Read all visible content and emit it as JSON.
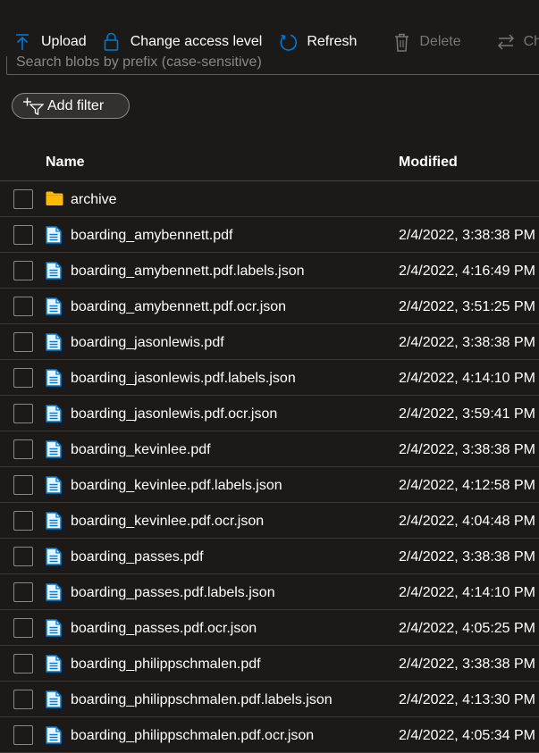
{
  "toolbar": {
    "upload_label": "Upload",
    "access_label": "Change access level",
    "refresh_label": "Refresh",
    "delete_label": "Delete",
    "change_label": "Cha"
  },
  "search": {
    "placeholder": "Search blobs by prefix (case-sensitive)"
  },
  "filter": {
    "label": "Add filter"
  },
  "table": {
    "columns": [
      "Name",
      "Modified"
    ],
    "rows": [
      {
        "type": "folder",
        "name": "archive",
        "modified": ""
      },
      {
        "type": "file",
        "name": "boarding_amybennett.pdf",
        "modified": "2/4/2022, 3:38:38 PM"
      },
      {
        "type": "file",
        "name": "boarding_amybennett.pdf.labels.json",
        "modified": "2/4/2022, 4:16:49 PM"
      },
      {
        "type": "file",
        "name": "boarding_amybennett.pdf.ocr.json",
        "modified": "2/4/2022, 3:51:25 PM"
      },
      {
        "type": "file",
        "name": "boarding_jasonlewis.pdf",
        "modified": "2/4/2022, 3:38:38 PM"
      },
      {
        "type": "file",
        "name": "boarding_jasonlewis.pdf.labels.json",
        "modified": "2/4/2022, 4:14:10 PM"
      },
      {
        "type": "file",
        "name": "boarding_jasonlewis.pdf.ocr.json",
        "modified": "2/4/2022, 3:59:41 PM"
      },
      {
        "type": "file",
        "name": "boarding_kevinlee.pdf",
        "modified": "2/4/2022, 3:38:38 PM"
      },
      {
        "type": "file",
        "name": "boarding_kevinlee.pdf.labels.json",
        "modified": "2/4/2022, 4:12:58 PM"
      },
      {
        "type": "file",
        "name": "boarding_kevinlee.pdf.ocr.json",
        "modified": "2/4/2022, 4:04:48 PM"
      },
      {
        "type": "file",
        "name": "boarding_passes.pdf",
        "modified": "2/4/2022, 3:38:38 PM"
      },
      {
        "type": "file",
        "name": "boarding_passes.pdf.labels.json",
        "modified": "2/4/2022, 4:14:10 PM"
      },
      {
        "type": "file",
        "name": "boarding_passes.pdf.ocr.json",
        "modified": "2/4/2022, 4:05:25 PM"
      },
      {
        "type": "file",
        "name": "boarding_philippschmalen.pdf",
        "modified": "2/4/2022, 3:38:38 PM"
      },
      {
        "type": "file",
        "name": "boarding_philippschmalen.pdf.labels.json",
        "modified": "2/4/2022, 4:13:30 PM"
      },
      {
        "type": "file",
        "name": "boarding_philippschmalen.pdf.ocr.json",
        "modified": "2/4/2022, 4:05:34 PM"
      }
    ]
  },
  "colors": {
    "background": "#1b1a19",
    "accent": "#0078d4",
    "folder": "#ffb900",
    "disabled": "#797775"
  },
  "icons": {
    "folder": "folder-icon",
    "file": "file-icon"
  }
}
